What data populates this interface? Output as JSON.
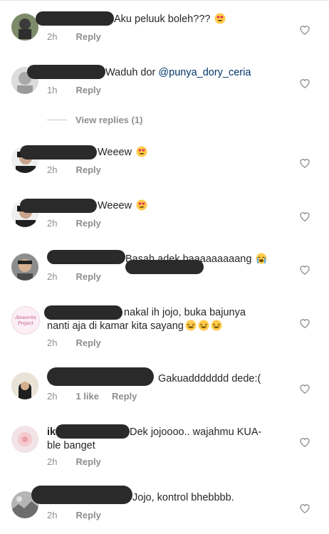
{
  "comments": [
    {
      "text": "Aku peluuk boleh??? ",
      "emoji": "heart-eyes",
      "time": "2h",
      "actions": [
        "Reply"
      ]
    },
    {
      "text": "Waduh dor ",
      "mention": "@punya_dory_ceria",
      "time": "1h",
      "actions": [
        "Reply"
      ]
    },
    {
      "text": "Weeew ",
      "emoji": "heart-eyes",
      "time": "2h",
      "actions": [
        "Reply"
      ]
    },
    {
      "text": "Weeew ",
      "emoji": "heart-eyes",
      "time": "2h",
      "actions": [
        "Reply"
      ]
    },
    {
      "text": "Basah adek baaaaaaaaang ",
      "emoji": "crying",
      "time": "2h",
      "actions": [
        "Reply"
      ]
    },
    {
      "text": "nakal ih jojo, buka bajunya nanti aja di kamar kita sayang",
      "emoji": "laughing",
      "time": "2h",
      "actions": [
        "Reply"
      ],
      "avatar_text": "Almeerits Project"
    },
    {
      "text": "Gakuaddddddd dede:(",
      "time": "2h",
      "actions": [
        "1 like",
        "Reply"
      ]
    },
    {
      "text": "Dek jojoooo.. wajahmu KUA-ble banget",
      "time": "2h",
      "actions": [
        "Reply"
      ],
      "username_prefix": "ik"
    },
    {
      "text": "Jojo, kontrol bhebbbb.",
      "time": "2h",
      "actions": [
        "Reply"
      ]
    }
  ],
  "view_replies": "View replies (1)",
  "colors": {
    "meta": "#8e8e8e",
    "mention": "#003569",
    "redaction": "#2a2a2a"
  }
}
